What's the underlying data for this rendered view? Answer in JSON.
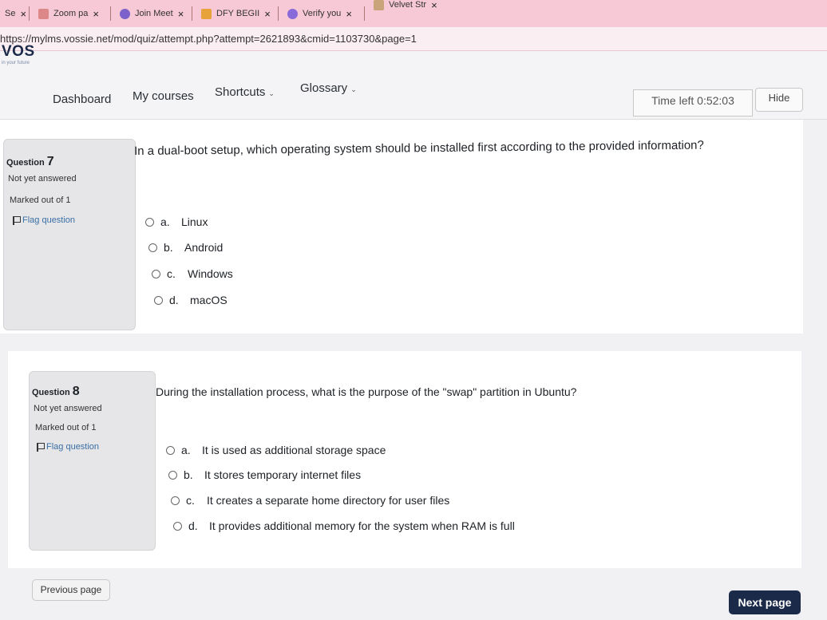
{
  "tabs": [
    {
      "label": "Se",
      "close": "×"
    },
    {
      "label": "Zoom pa",
      "close": "×"
    },
    {
      "label": "Join Meet",
      "close": "×"
    },
    {
      "label": "DFY BEGII",
      "close": "×"
    },
    {
      "label": "Verify you",
      "close": "×"
    },
    {
      "label": "Velvet Str",
      "close": "×"
    }
  ],
  "address": {
    "url": "https://mylms.vossie.net/mod/quiz/attempt.php?attempt=2621893&cmid=1103730&page=1"
  },
  "nav": {
    "logo": "VOS",
    "logo_sub": "in your future",
    "items": [
      "Dashboard",
      "My courses",
      "Shortcuts",
      "Glossary"
    ],
    "timer": "Time left 0:52:03",
    "hide_label": "Hide"
  },
  "questions": [
    {
      "number_prefix": "Question",
      "number": "7",
      "status": "Not yet answered",
      "marks": "Marked out of 1",
      "flag_label": "Flag question",
      "text": "In a dual-boot setup, which operating system should be installed first according to the provided information?",
      "options": [
        {
          "letter": "a.",
          "text": "Linux"
        },
        {
          "letter": "b.",
          "text": "Android"
        },
        {
          "letter": "c.",
          "text": "Windows"
        },
        {
          "letter": "d.",
          "text": "macOS"
        }
      ]
    },
    {
      "number_prefix": "Question",
      "number": "8",
      "status": "Not yet answered",
      "marks": "Marked out of 1",
      "flag_label": "Flag question",
      "text": "During the installation process, what is the purpose of the \"swap\" partition in Ubuntu?",
      "options": [
        {
          "letter": "a.",
          "text": "It is used as additional storage space"
        },
        {
          "letter": "b.",
          "text": "It stores temporary internet files"
        },
        {
          "letter": "c.",
          "text": "It creates a separate home directory for user files"
        },
        {
          "letter": "d.",
          "text": "It provides additional memory for the system when RAM is full"
        }
      ]
    }
  ],
  "footer": {
    "prev_label": "Previous page",
    "next_label": "Next page"
  },
  "colors": {
    "tabbar": "#f7c9d6",
    "brand": "#1b2a48",
    "link": "#3a6ea5"
  }
}
